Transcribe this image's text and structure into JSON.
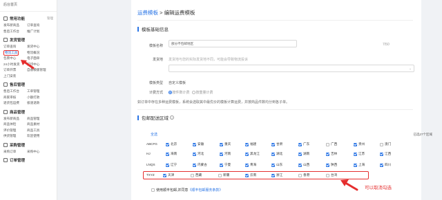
{
  "sidebar": {
    "top": "后台首页",
    "sections": [
      {
        "title": "常用功能",
        "extra": "管理",
        "items": [
          "发布新商品",
          "订单查询",
          "售后工作台",
          "推广计划"
        ]
      },
      {
        "title": "发货管理",
        "extra": "",
        "items": [
          "订单查询",
          "发货中心",
          "物流工具",
          "物流概况",
          "包裹中心",
          "电子面单",
          "24小时发货",
          "打印中心",
          "订单开票",
          "自备模版管理",
          "上门安装",
          ""
        ]
      },
      {
        "title": "售后管理",
        "extra": "",
        "items": [
          "售后工作台",
          "工单管理",
          "商家审核",
          "小额打款",
          "退货包运费",
          "极速退款"
        ]
      },
      {
        "title": "商品管理",
        "extra": "",
        "items": [
          "发布新商品",
          "商品管理",
          "商品体检",
          "商品素材",
          "评价管理",
          "商品工具",
          "供货管理",
          "欢迎使用"
        ]
      },
      {
        "title": "采购管理",
        "extra": "",
        "items": [
          "采购订单",
          "采购中心"
        ]
      },
      {
        "title": "订单管理",
        "extra": "",
        "items": []
      }
    ],
    "active_item": "物流工具"
  },
  "breadcrumb": {
    "parent": "运费模板",
    "sep": " > ",
    "current": "编辑运费模板"
  },
  "basic": {
    "title": "模板基础信息",
    "name_label": "模板名称",
    "name_value": "部分不包邮地区",
    "name_count": "7/50",
    "ship_label": "发货地",
    "ship_placeholder": "发货地与您的实际发货地不同，可能会导致物流投诉",
    "type_label": "模板类型",
    "type_value": "自定义模板",
    "calc_label": "计费方式",
    "calc_opt1": "按件数计费",
    "calc_opt2": "按重量计费",
    "tip": "如订单中存在多种运费模板，系统会选取其中最优价的模板计算运费，并按商品件数均分到各子单。"
  },
  "region": {
    "title": "包邮配送区域",
    "help": "?",
    "select_all": "全选",
    "selected_count": "已选27个区域",
    "rows": [
      {
        "group": "ABCFG",
        "items": [
          {
            "n": "北京",
            "c": true
          },
          {
            "n": "安徽",
            "c": true
          },
          {
            "n": "重庆",
            "c": true
          },
          {
            "n": "福建",
            "c": true
          },
          {
            "n": "甘肃",
            "c": true
          },
          {
            "n": "广东",
            "c": true
          },
          {
            "n": "广西",
            "c": false
          },
          {
            "n": "贵州",
            "c": true
          },
          {
            "n": "澳门",
            "c": false
          }
        ]
      },
      {
        "group": "HJ",
        "items": [
          {
            "n": "海南",
            "c": true
          },
          {
            "n": "河北",
            "c": true
          },
          {
            "n": "河南",
            "c": true
          },
          {
            "n": "黑龙江",
            "c": true
          },
          {
            "n": "湖北",
            "c": true
          },
          {
            "n": "湖南",
            "c": true
          },
          {
            "n": "吉林",
            "c": true
          },
          {
            "n": "江苏",
            "c": true
          },
          {
            "n": "江西",
            "c": true
          }
        ]
      },
      {
        "group": "LNQS",
        "items": [
          {
            "n": "辽宁",
            "c": true
          },
          {
            "n": "内蒙古",
            "c": true
          },
          {
            "n": "宁夏",
            "c": true
          },
          {
            "n": "青海",
            "c": true
          },
          {
            "n": "山东",
            "c": true
          },
          {
            "n": "山西",
            "c": true
          },
          {
            "n": "陕西",
            "c": true
          },
          {
            "n": "上海",
            "c": true
          },
          {
            "n": "四川",
            "c": true
          }
        ]
      },
      {
        "group": "TXYZ",
        "items": [
          {
            "n": "天津",
            "c": true
          },
          {
            "n": "西藏",
            "c": false
          },
          {
            "n": "新疆",
            "c": false
          },
          {
            "n": "云南",
            "c": true
          },
          {
            "n": "浙江",
            "c": true
          },
          {
            "n": "香港",
            "c": false
          },
          {
            "n": "台湾",
            "c": false
          }
        ]
      }
    ],
    "agree_prefix": "使用顺丰包邮,并同意",
    "agree_link": "《顺丰包邮服务条款》",
    "note": "可以取消勾选"
  },
  "colors": {
    "accent": "#2a75e6",
    "highlight": "#e52e2e"
  }
}
